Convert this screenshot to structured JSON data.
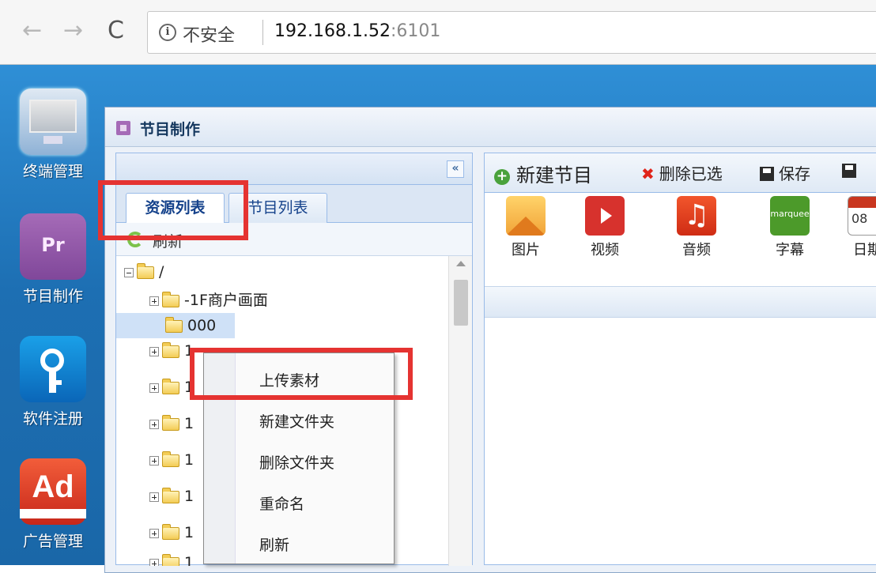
{
  "browser": {
    "back_icon": "arrow-left-icon",
    "forward_icon": "arrow-right-icon",
    "reload_icon": "reload-icon",
    "info_glyph": "i",
    "security_label": "不安全",
    "host": "192.168.1.52",
    "port": ":6101"
  },
  "desktop": {
    "icons": [
      {
        "label": "终端管理",
        "icon": "monitor-icon"
      },
      {
        "label": "节目制作",
        "icon": "premiere-icon",
        "glyph": "Pr"
      },
      {
        "label": "软件注册",
        "icon": "key-icon"
      },
      {
        "label": "广告管理",
        "icon": "adaware-icon",
        "glyph": "Ad"
      }
    ]
  },
  "window": {
    "title": "节目制作",
    "collapse_glyph": "«",
    "tabs": [
      {
        "label": "资源列表",
        "active": true
      },
      {
        "label": "节目列表",
        "active": false
      }
    ],
    "refresh_label": "刷新",
    "tree": {
      "root": "/",
      "items": [
        {
          "label": "-1F商户画面",
          "expandable": true
        },
        {
          "label": "000",
          "expandable": false,
          "selected": true
        },
        {
          "label": "1",
          "expandable": true
        },
        {
          "label": "1",
          "expandable": true
        },
        {
          "label": "1",
          "expandable": true
        },
        {
          "label": "1",
          "expandable": true
        },
        {
          "label": "1",
          "expandable": true
        },
        {
          "label": "1",
          "expandable": true
        },
        {
          "label": "1",
          "expandable": true
        }
      ]
    }
  },
  "context_menu": {
    "items": [
      "上传素材",
      "新建文件夹",
      "删除文件夹",
      "重命名",
      "刷新"
    ]
  },
  "right_panel": {
    "toolbar": [
      {
        "label": "新建节目",
        "icon": "add-circle-icon"
      },
      {
        "label": "删除已选",
        "icon": "delete-x-icon"
      },
      {
        "label": "保存",
        "icon": "save-icon"
      }
    ],
    "media_types": [
      {
        "label": "图片",
        "icon": "picture-icon"
      },
      {
        "label": "视频",
        "icon": "video-icon"
      },
      {
        "label": "音频",
        "icon": "audio-icon",
        "glyph": "♫"
      },
      {
        "label": "字幕",
        "icon": "marquee-icon",
        "glyph": "marquee"
      },
      {
        "label": "日期",
        "icon": "calendar-icon",
        "glyph": "08"
      }
    ]
  },
  "colors": {
    "desktop_blue": "#1d6fb3",
    "annotation_red": "#e53331",
    "panel_border": "#99bbe8"
  }
}
